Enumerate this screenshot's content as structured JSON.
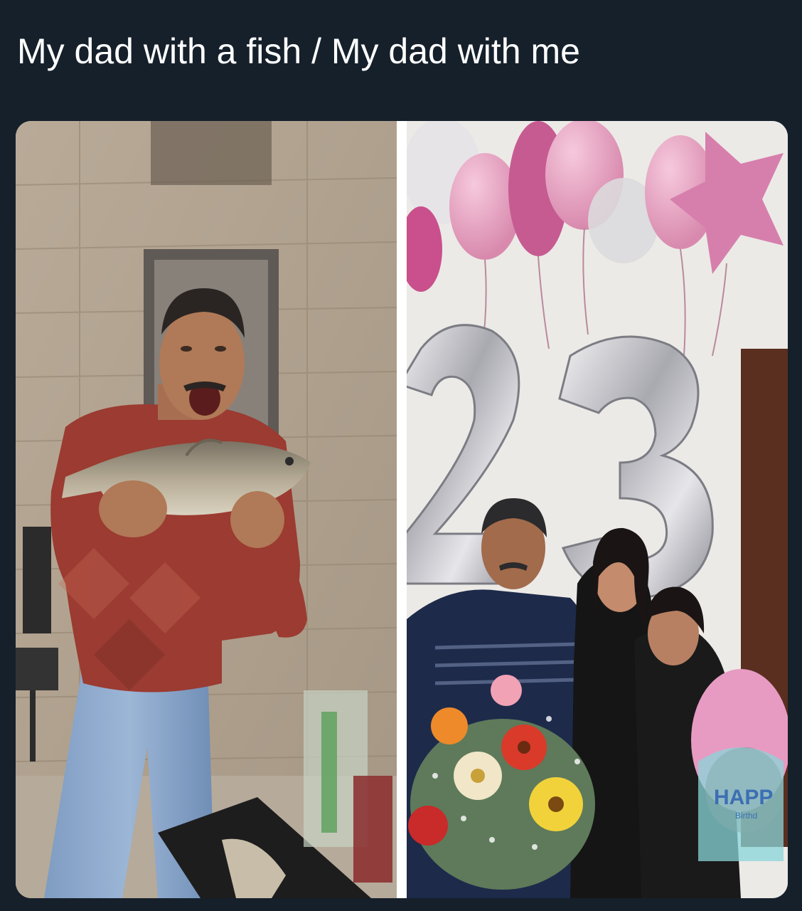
{
  "post": {
    "text": "My dad with a fish / My dad with me"
  },
  "media": {
    "panels": [
      {
        "description_icon": "photo-man-holding-fish"
      },
      {
        "description_icon": "photo-birthday-family-23"
      }
    ],
    "left_photo_text": {},
    "right_photo_text": {
      "balloon_number": "23",
      "balloon_print": "HAPP",
      "balloon_print_small": "Birthd"
    }
  },
  "colors": {
    "background": "#15202b",
    "text": "#ffffff"
  }
}
